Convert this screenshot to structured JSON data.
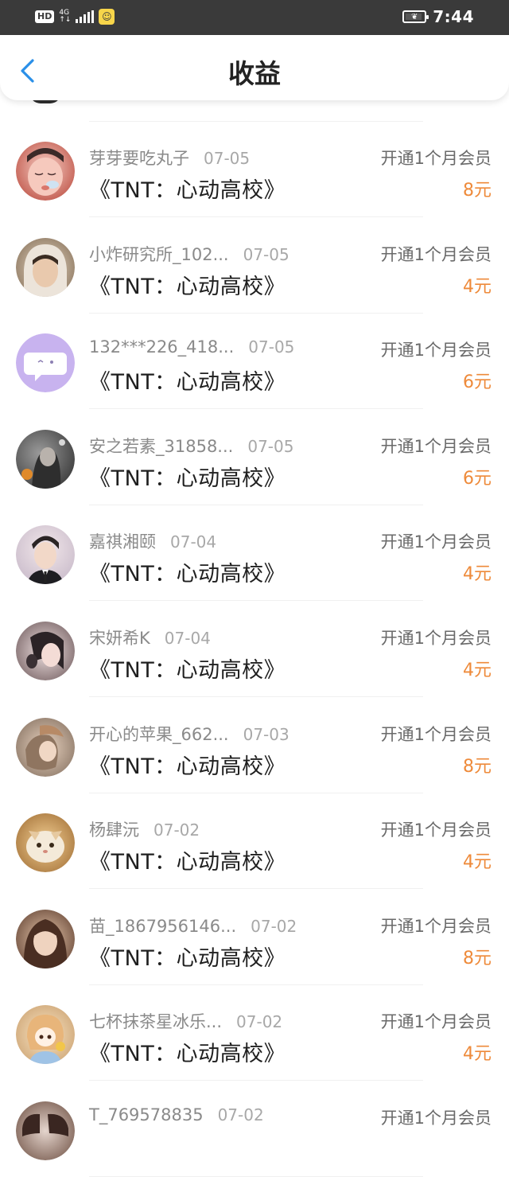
{
  "status_bar": {
    "hd": "HD",
    "network": "4G",
    "time": "7:44",
    "icons": [
      "signal-icon",
      "app-notification-icon",
      "battery-icon"
    ]
  },
  "header": {
    "title": "收益",
    "back_icon": "chevron-left-icon"
  },
  "colors": {
    "accent_blue": "#2a8fe8",
    "amount_orange": "#ee8a3a",
    "status_bar_bg": "#3a3a3a"
  },
  "earnings": [
    {
      "name": "芽芽要吃丸子",
      "date": "07-05",
      "book": "《TNT：心动高校》",
      "desc": "开通1个月会员",
      "amount": "8元"
    },
    {
      "name": "小炸研究所_102...",
      "date": "07-05",
      "book": "《TNT：心动高校》",
      "desc": "开通1个月会员",
      "amount": "4元"
    },
    {
      "name": "132***226_418...",
      "date": "07-05",
      "book": "《TNT：心动高校》",
      "desc": "开通1个月会员",
      "amount": "6元"
    },
    {
      "name": "安之若素_31858...",
      "date": "07-05",
      "book": "《TNT：心动高校》",
      "desc": "开通1个月会员",
      "amount": "6元"
    },
    {
      "name": "嘉祺湘颐",
      "date": "07-04",
      "book": "《TNT：心动高校》",
      "desc": "开通1个月会员",
      "amount": "4元"
    },
    {
      "name": "宋妍希K",
      "date": "07-04",
      "book": "《TNT：心动高校》",
      "desc": "开通1个月会员",
      "amount": "4元"
    },
    {
      "name": "开心的苹果_662...",
      "date": "07-03",
      "book": "《TNT：心动高校》",
      "desc": "开通1个月会员",
      "amount": "8元"
    },
    {
      "name": "杨肆沅",
      "date": "07-02",
      "book": "《TNT：心动高校》",
      "desc": "开通1个月会员",
      "amount": "4元"
    },
    {
      "name": "苗_1867956146...",
      "date": "07-02",
      "book": "《TNT：心动高校》",
      "desc": "开通1个月会员",
      "amount": "8元"
    },
    {
      "name": "七杯抹茶星冰乐...",
      "date": "07-02",
      "book": "《TNT：心动高校》",
      "desc": "开通1个月会员",
      "amount": "4元"
    },
    {
      "name": "T_769578835",
      "date": "07-02",
      "book": "",
      "desc": "开通1个月会员",
      "amount": ""
    }
  ]
}
